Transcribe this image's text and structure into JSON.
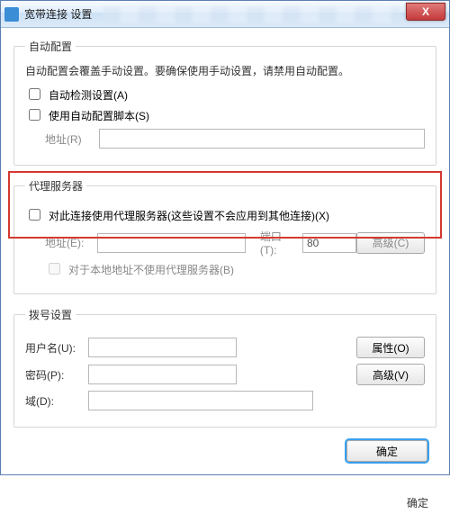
{
  "window": {
    "title": "宽带连接 设置",
    "close_glyph": "X"
  },
  "auto_config": {
    "legend": "自动配置",
    "desc": "自动配置会覆盖手动设置。要确保使用手动设置，请禁用自动配置。",
    "detect_label": "自动检测设置(A)",
    "script_label": "使用自动配置脚本(S)",
    "addr_label": "地址(R)"
  },
  "proxy": {
    "legend": "代理服务器",
    "use_label": "对此连接使用代理服务器(这些设置不会应用到其他连接)(X)",
    "addr_label": "地址(E):",
    "port_label": "端口(T):",
    "port_value": "80",
    "advanced_btn": "高级(C)",
    "bypass_label": "对于本地地址不使用代理服务器(B)"
  },
  "dial": {
    "legend": "拨号设置",
    "user_label": "用户名(U):",
    "pwd_label": "密码(P):",
    "domain_label": "域(D):",
    "props_btn": "属性(O)",
    "adv_btn": "高级(V)"
  },
  "footer": {
    "ok": "确定",
    "outside_ok": "确定"
  }
}
